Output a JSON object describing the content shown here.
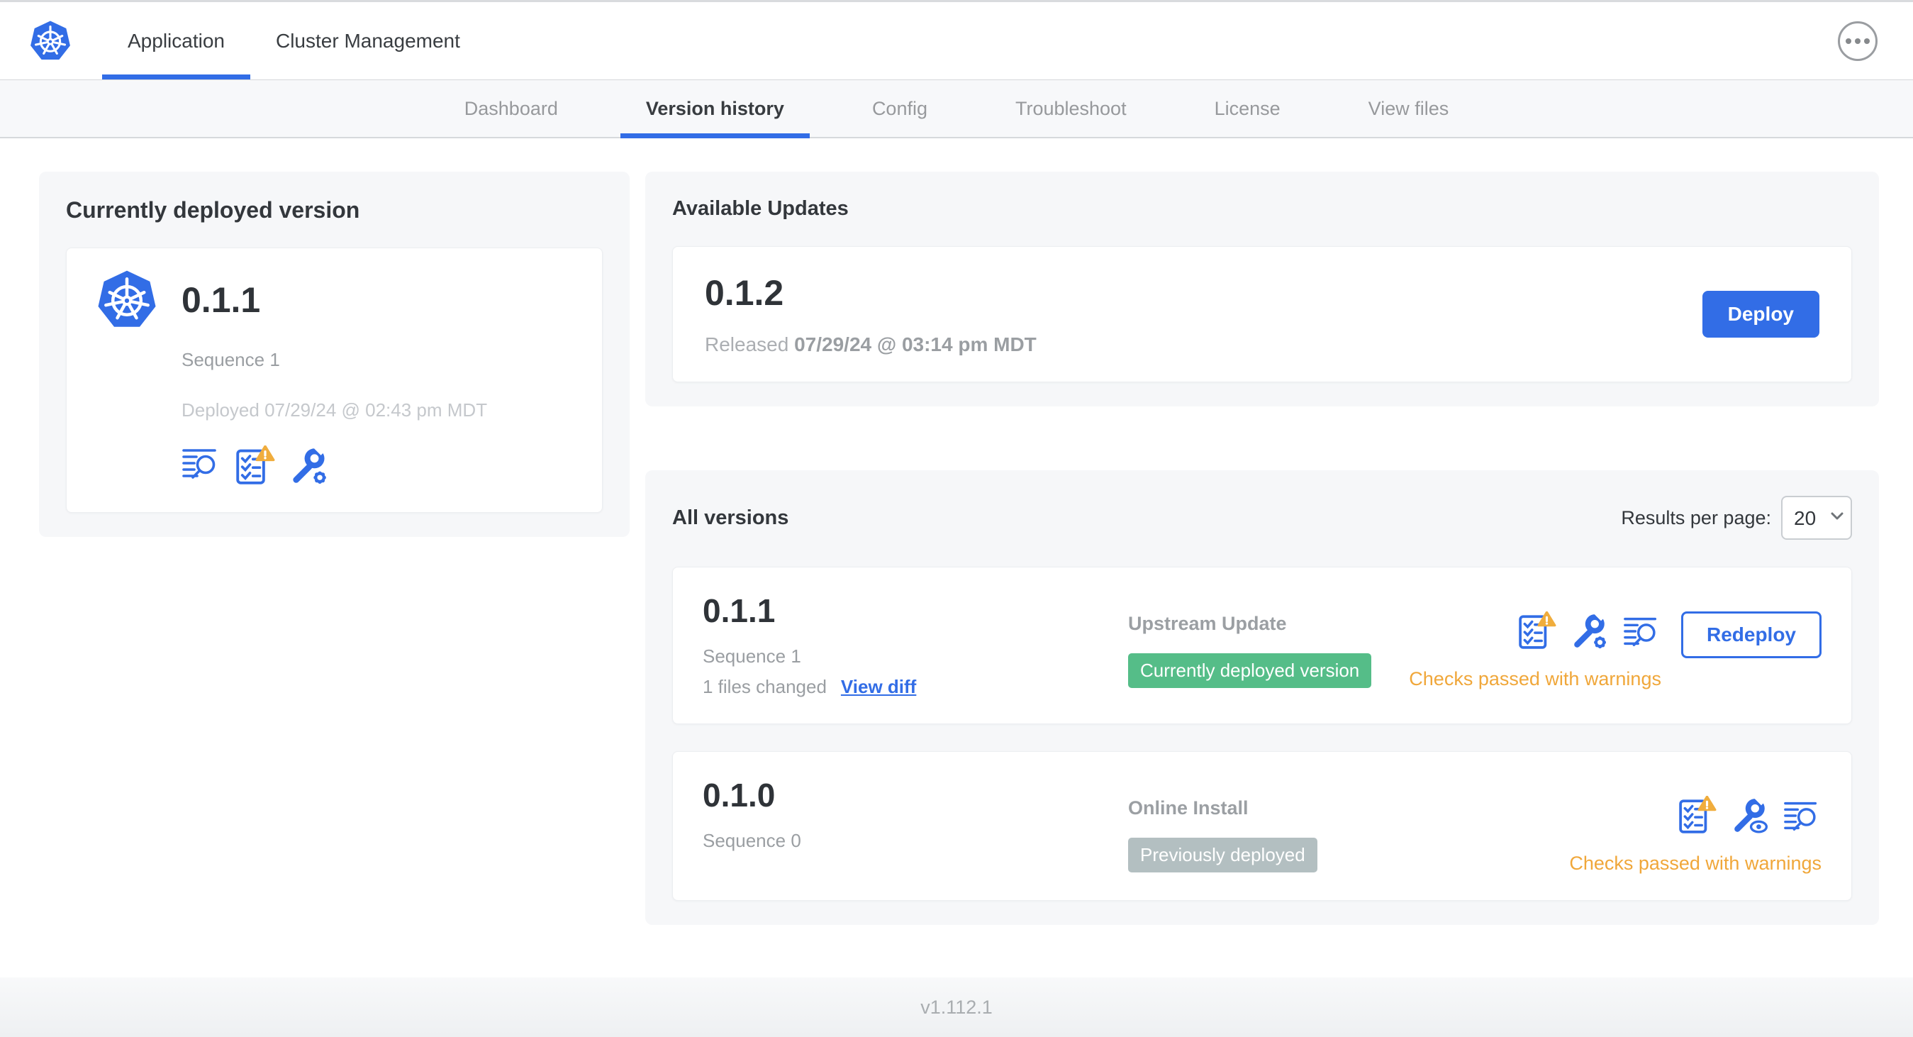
{
  "colors": {
    "primary_blue": "#326de6",
    "badge_green": "#55bd88",
    "badge_gray": "#b3bfc1",
    "warning_amber": "#f0a73a"
  },
  "icons": {
    "brand": "kubernetes-wheel",
    "more_menu": "ellipsis-in-circle",
    "diff_logs": "text-lines-magnifier",
    "preflight_warning": "checklist-with-warning-triangle",
    "edit_config": "wrench-with-gear",
    "view_config": "wrench-with-eye",
    "select_arrow": "chevron-down"
  },
  "header": {
    "app_tabs": [
      {
        "label": "Application",
        "active": true
      },
      {
        "label": "Cluster Management",
        "active": false
      }
    ]
  },
  "subnav": {
    "tabs": [
      "Dashboard",
      "Version history",
      "Config",
      "Troubleshoot",
      "License",
      "View files"
    ],
    "active_tab": "Version history"
  },
  "current_version": {
    "title": "Currently deployed version",
    "version": "0.1.1",
    "sequence": "Sequence 1",
    "deployed": "Deployed 07/29/24 @ 02:43 pm MDT"
  },
  "available_updates": {
    "title": "Available Updates",
    "version": "0.1.2",
    "released_label": "Released",
    "released_date": "07/29/24 @ 03:14 pm MDT",
    "deploy_button": "Deploy"
  },
  "all_versions": {
    "title": "All versions",
    "results_per_page_label": "Results per page:",
    "results_per_page_value": "20",
    "rows": [
      {
        "version": "0.1.1",
        "sequence": "Sequence 1",
        "files_changed": "1 files changed",
        "view_diff_link": "View diff",
        "source": "Upstream Update",
        "badge": "Currently deployed version",
        "badge_style": "green",
        "status": "Checks passed with warnings",
        "action_button": "Redeploy"
      },
      {
        "version": "0.1.0",
        "sequence": "Sequence 0",
        "source": "Online Install",
        "badge": "Previously deployed",
        "badge_style": "gray",
        "status": "Checks passed with warnings"
      }
    ]
  },
  "footer": {
    "app_version": "v1.112.1"
  }
}
